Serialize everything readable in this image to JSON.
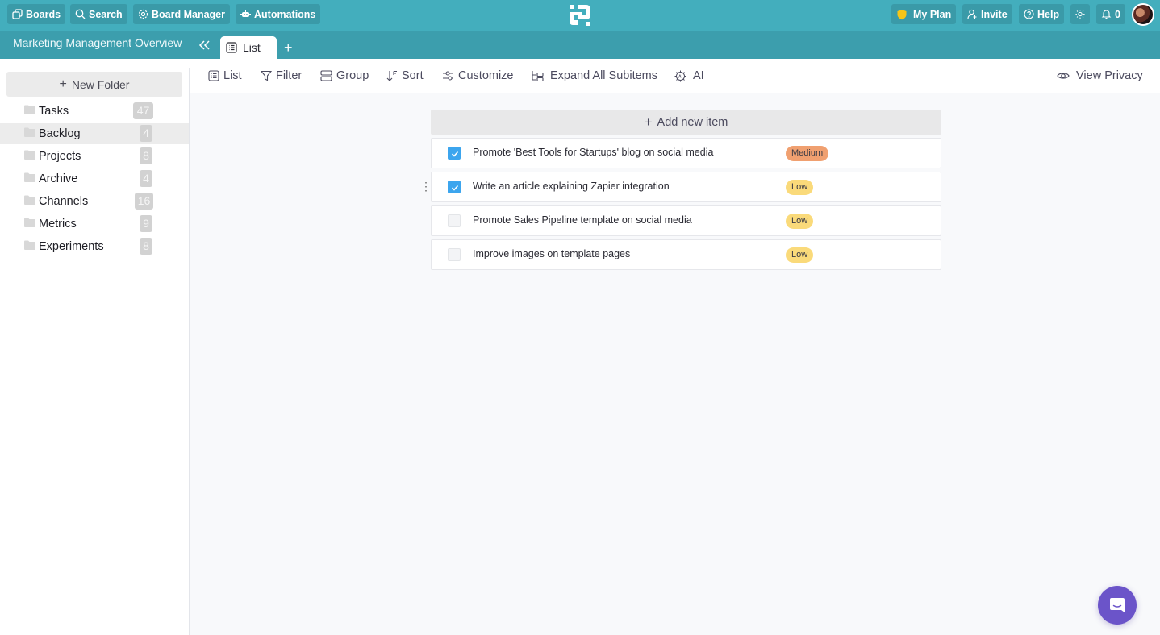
{
  "topbar": {
    "left_buttons": [
      {
        "label": "Boards",
        "icon": "boards-icon"
      },
      {
        "label": "Search",
        "icon": "search-icon"
      },
      {
        "label": "Board Manager",
        "icon": "gear-icon"
      },
      {
        "label": "Automations",
        "icon": "robot-icon"
      }
    ],
    "right_buttons": [
      {
        "label": "My Plan",
        "icon": "shield-icon"
      },
      {
        "label": "Invite",
        "icon": "add-user-icon"
      },
      {
        "label": "Help",
        "icon": "help-icon"
      },
      {
        "label": "",
        "icon": "sun-icon"
      },
      {
        "label": "0",
        "icon": "bell-icon"
      }
    ],
    "colors": {
      "bar": "#43aebd",
      "button": "#3a9aa8",
      "shield": "#f5c518"
    }
  },
  "board": {
    "title": "Marketing Management Overview",
    "tabs": [
      {
        "label": "List",
        "active": true
      }
    ],
    "add_tab_label": "+"
  },
  "sidebar": {
    "new_folder_label": "New Folder",
    "folders": [
      {
        "label": "Tasks",
        "count": "47",
        "active": false
      },
      {
        "label": "Backlog",
        "count": "4",
        "active": true
      },
      {
        "label": "Projects",
        "count": "8",
        "active": false
      },
      {
        "label": "Archive",
        "count": "4",
        "active": false
      },
      {
        "label": "Channels",
        "count": "16",
        "active": false
      },
      {
        "label": "Metrics",
        "count": "9",
        "active": false
      },
      {
        "label": "Experiments",
        "count": "8",
        "active": false
      }
    ]
  },
  "toolbar": {
    "items": [
      {
        "label": "List",
        "icon": "list-icon"
      },
      {
        "label": "Filter",
        "icon": "filter-icon"
      },
      {
        "label": "Group",
        "icon": "group-icon"
      },
      {
        "label": "Sort",
        "icon": "sort-icon"
      },
      {
        "label": "Customize",
        "icon": "customize-icon"
      },
      {
        "label": "Expand All Subitems",
        "icon": "expand-subitems-icon"
      },
      {
        "label": "AI",
        "icon": "ai-chip-icon"
      }
    ],
    "view_privacy_label": "View Privacy"
  },
  "list": {
    "add_item_label": "Add new item",
    "items": [
      {
        "title": "Promote 'Best Tools for Startups' blog on social media",
        "checked": true,
        "priority": "Medium",
        "priority_color": "#f0a070"
      },
      {
        "title": "Write an article explaining Zapier integration",
        "checked": true,
        "priority": "Low",
        "priority_color": "#fada7a"
      },
      {
        "title": "Promote Sales Pipeline template on social media",
        "checked": false,
        "priority": "Low",
        "priority_color": "#fada7a"
      },
      {
        "title": "Improve images on template pages",
        "checked": false,
        "priority": "Low",
        "priority_color": "#fada7a"
      }
    ]
  },
  "chat": {
    "icon": "chat-icon",
    "color": "#6b54c9"
  }
}
